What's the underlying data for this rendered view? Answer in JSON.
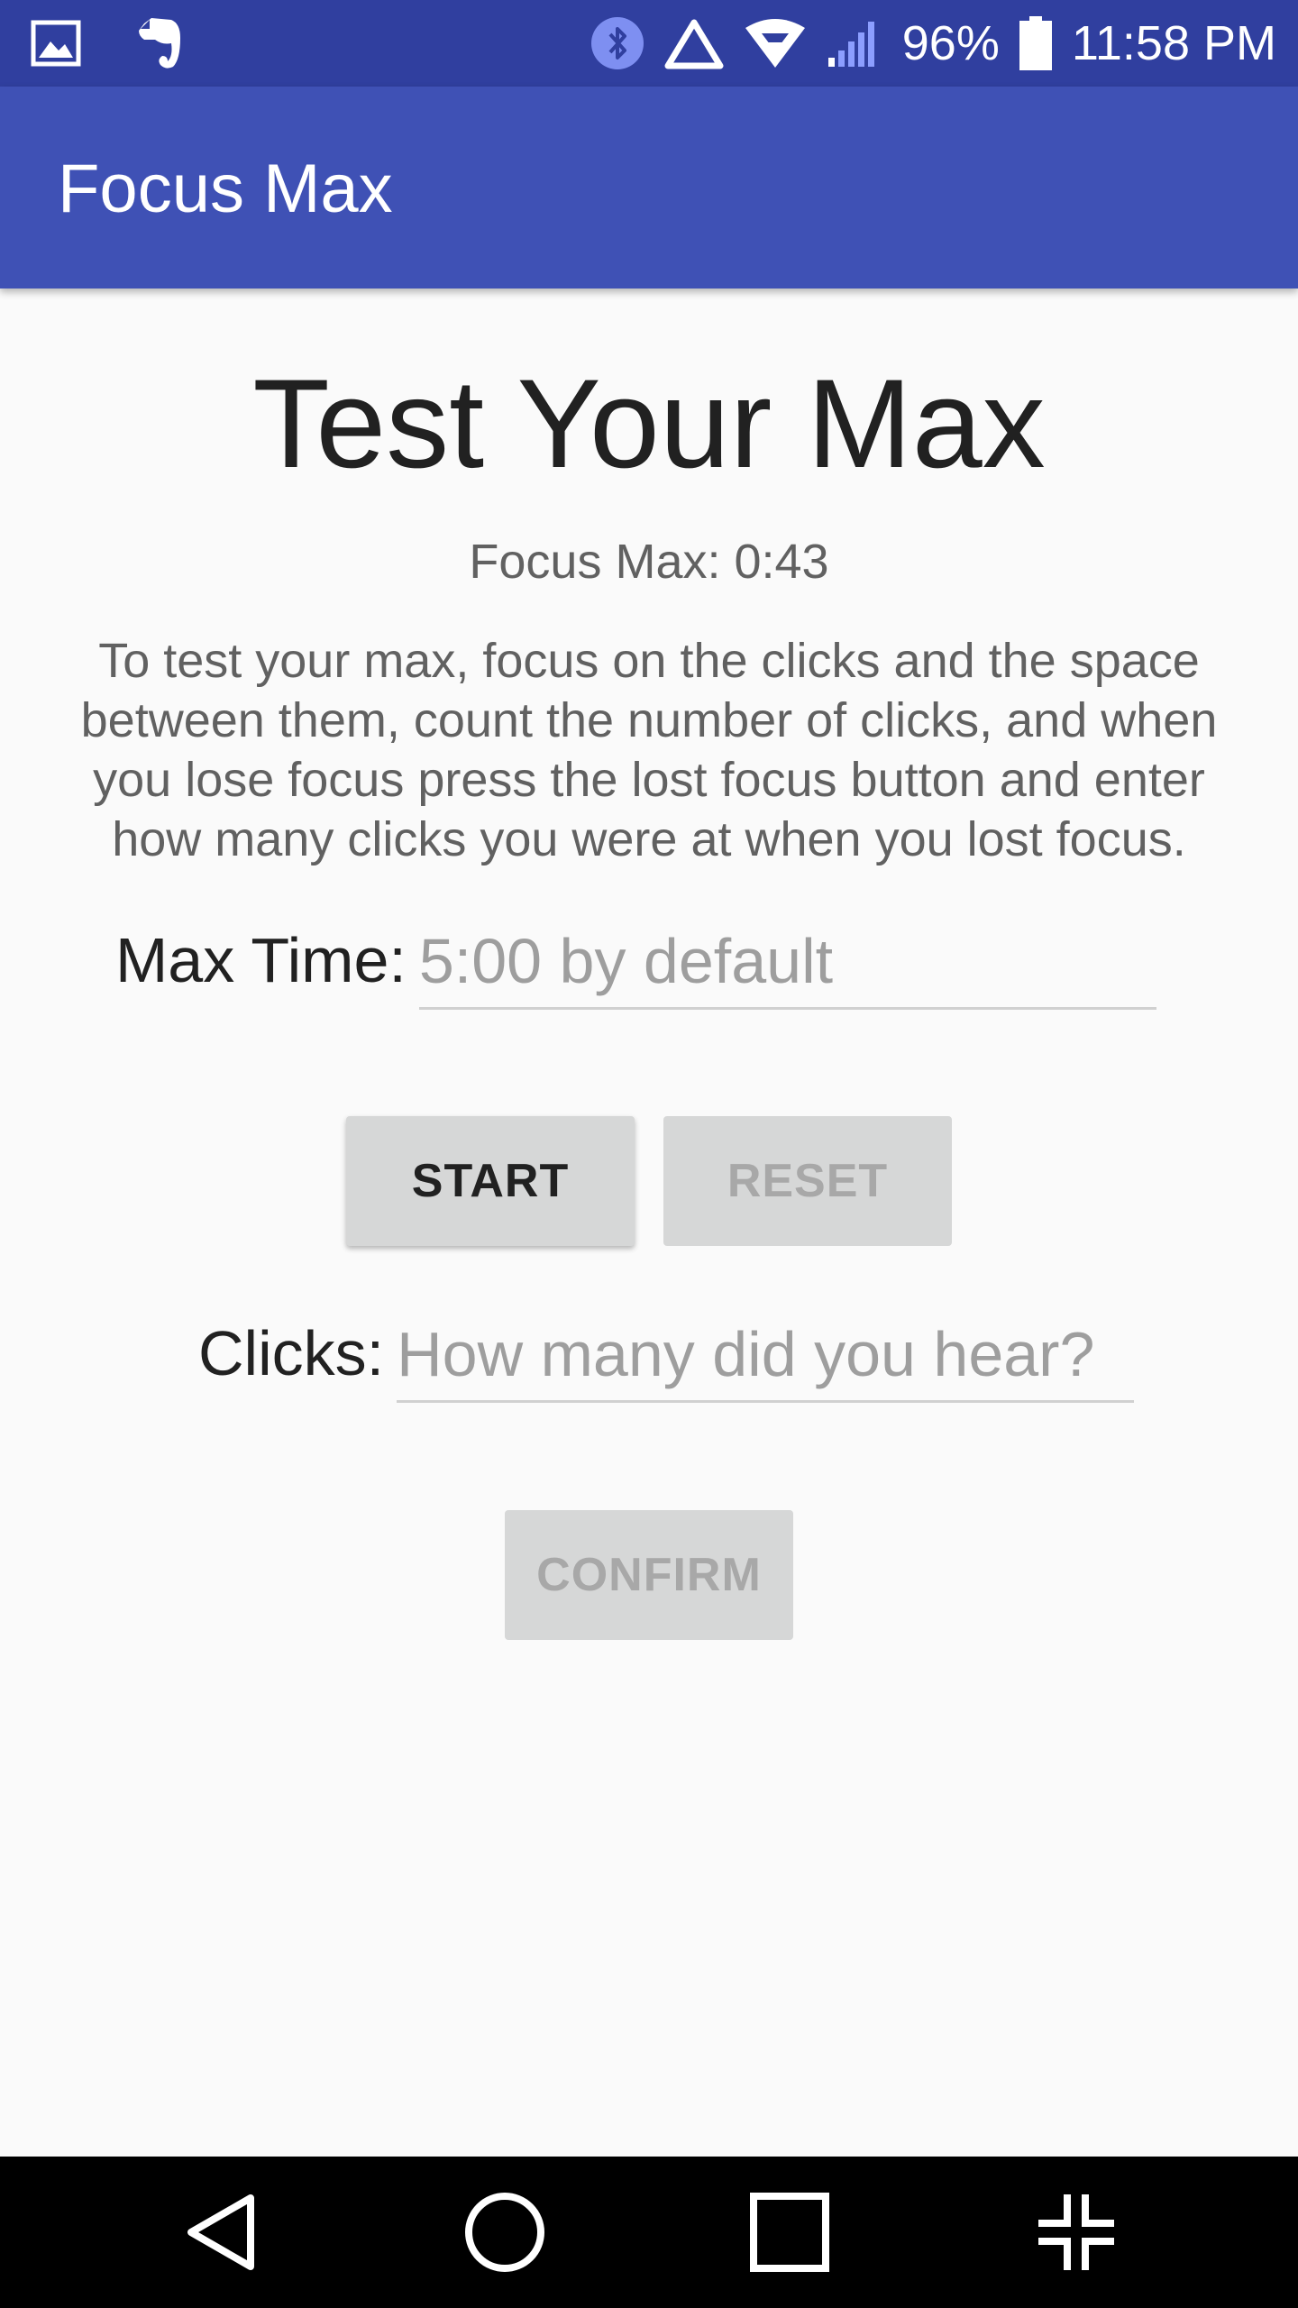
{
  "status_bar": {
    "battery_percent": "96%",
    "time": "11:58 PM",
    "icons_left": [
      "gallery-icon",
      "evernote-icon"
    ],
    "icons_right": [
      "bluetooth-icon",
      "alert-triangle-icon",
      "wifi-icon",
      "cell-signal-icon",
      "battery-icon"
    ]
  },
  "app_bar": {
    "title": "Focus Max"
  },
  "main": {
    "heading": "Test Your Max",
    "focus_max_label": "Focus Max: 0:43",
    "instructions": "To test your max, focus on the clicks and the space between them, count the number of clicks, and when you lose focus press the lost focus button and enter how many clicks you were at when you lost focus.",
    "max_time": {
      "label": "Max Time:",
      "value": "",
      "placeholder": "5:00 by default"
    },
    "start_button": "START",
    "reset_button": "RESET",
    "clicks": {
      "label": "Clicks:",
      "value": "",
      "placeholder": "How many did you hear?"
    },
    "confirm_button": "CONFIRM"
  },
  "nav_bar": {
    "icons": [
      "back-icon",
      "home-icon",
      "recents-icon",
      "collapse-icon"
    ]
  },
  "colors": {
    "status_bar": "#303f9f",
    "app_bar": "#3f51b5",
    "background": "#fafafa",
    "button": "#d6d7d7"
  }
}
